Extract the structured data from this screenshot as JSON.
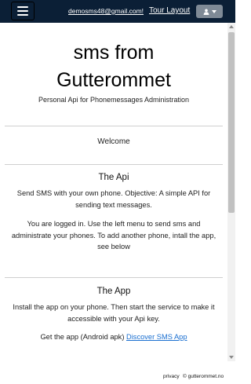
{
  "nav": {
    "email": "demosms48@gmail.com!",
    "tour_link": "Tour Layout",
    "menu_icon": "hamburger-menu-icon",
    "user_icon": "user-icon"
  },
  "hero": {
    "title_line1": "sms from",
    "title_line2": "Gutterommet",
    "subtitle": "Personal Api for Phonemessages Administration"
  },
  "welcome": "Welcome",
  "api_section": {
    "title": "The Api",
    "para1": "Send SMS with your own phone. Objective: A simple API for sending text messages.",
    "para2": "You are logged in. Use the left menu to send sms and administrate your phones. To add another phone, intall the app, see below"
  },
  "app_section": {
    "title": "The App",
    "para1": "Install the app on your phone. Then start the service to make it accessible with your Api key.",
    "para2_prefix": "Get the app (Android apk) ",
    "para2_link": "Discover SMS App"
  },
  "footer": {
    "privacy": "privacy",
    "copyright": "© gutterommet.no"
  },
  "colors": {
    "navbar": "#0b1f36",
    "user_button": "#7f8a96",
    "link": "#1a6fd0"
  }
}
